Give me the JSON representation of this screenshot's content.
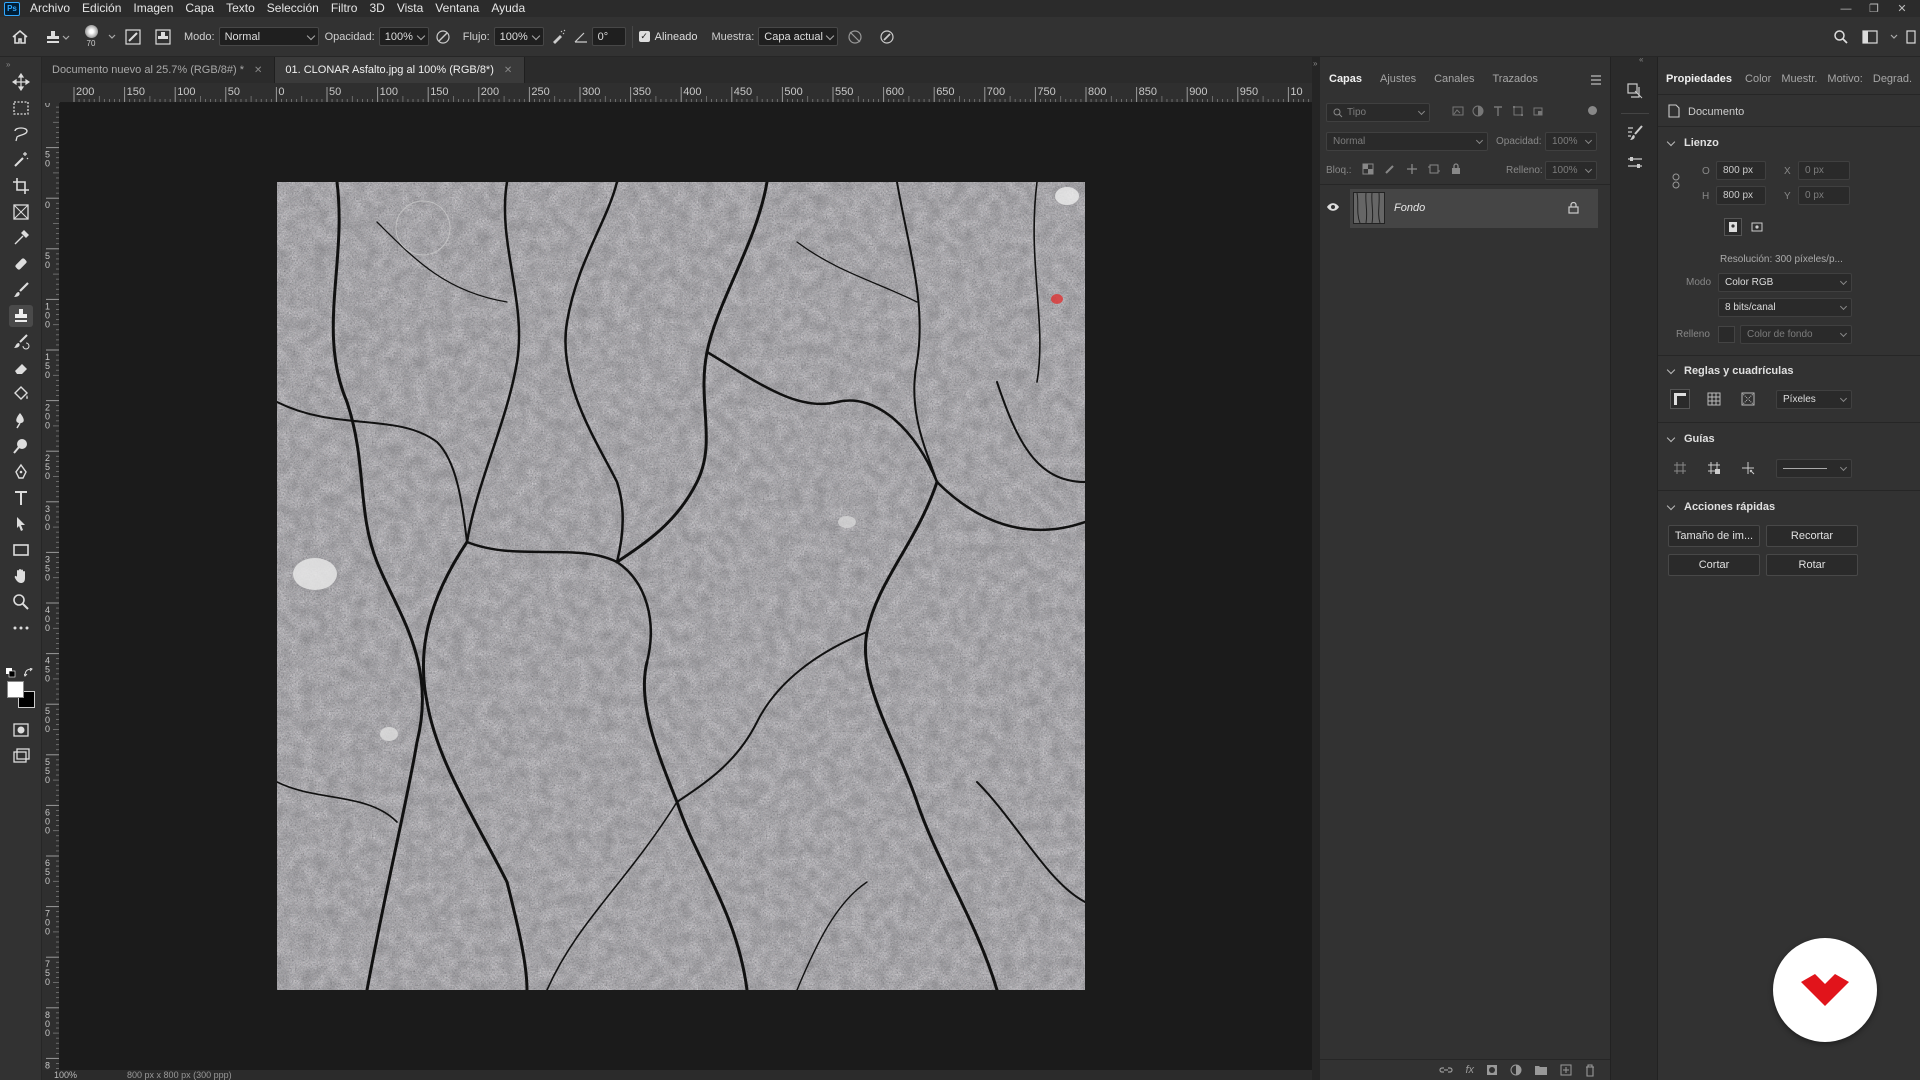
{
  "menubar": {
    "logo": "Ps",
    "items": [
      "Archivo",
      "Edición",
      "Imagen",
      "Capa",
      "Texto",
      "Selección",
      "Filtro",
      "3D",
      "Vista",
      "Ventana",
      "Ayuda"
    ]
  },
  "options": {
    "brush_size": "70",
    "mode_label": "Modo:",
    "mode_value": "Normal",
    "opacity_label": "Opacidad:",
    "opacity_value": "100%",
    "flow_label": "Flujo:",
    "flow_value": "100%",
    "angle_value": "0°",
    "aligned_label": "Alineado",
    "sample_label": "Muestra:",
    "sample_value": "Capa actual"
  },
  "tabs": [
    {
      "label": "Documento nuevo al 25.7% (RGB/8#) *"
    },
    {
      "label": "01. CLONAR Asfalto.jpg al 100% (RGB/8*)"
    }
  ],
  "ruler": {
    "h_labels": [
      "200",
      "150",
      "100",
      "50",
      "0",
      "50",
      "100",
      "150",
      "200",
      "250",
      "300",
      "350",
      "400",
      "450",
      "500",
      "550",
      "600",
      "650",
      "700",
      "750",
      "800",
      "850",
      "900",
      "950",
      "10"
    ],
    "v_labels": [
      "0",
      "50",
      "0",
      "50",
      "100",
      "150",
      "200",
      "250",
      "300",
      "350",
      "400",
      "450",
      "500",
      "550",
      "600",
      "650",
      "700",
      "750",
      "800",
      "850"
    ]
  },
  "status": {
    "zoom": "100%",
    "size": "800 px x 800 px (300 ppp)"
  },
  "layers_panel": {
    "tabs": [
      "Capas",
      "Ajustes",
      "Canales",
      "Trazados"
    ],
    "filter_placeholder": "Tipo",
    "blend_mode": "Normal",
    "opacity_label": "Opacidad:",
    "opacity_value": "100%",
    "lock_label": "Bloq.:",
    "fill_label": "Relleno:",
    "fill_value": "100%",
    "layers": [
      {
        "name": "Fondo"
      }
    ]
  },
  "properties_panel": {
    "tabs": [
      "Propiedades",
      "Color",
      "Muestr.",
      "Motivo:",
      "Degrad."
    ],
    "doc_label": "Documento",
    "canvas_section": "Lienzo",
    "width_label": "O",
    "width_value": "800 px",
    "height_label": "H",
    "height_value": "800 px",
    "x_label": "X",
    "x_value": "0 px",
    "y_label": "Y",
    "y_value": "0 px",
    "resolution": "Resolución: 300 píxeles/p...",
    "mode_label": "Modo",
    "mode_value": "Color RGB",
    "bits_value": "8 bits/canal",
    "fill_label": "Relleno",
    "fill_value": "Color de fondo",
    "rulers_section": "Reglas y cuadrículas",
    "units_value": "Píxeles",
    "guides_section": "Guías",
    "quick_section": "Acciones rápidas",
    "btn_image_size": "Tamaño de im...",
    "btn_crop": "Recortar",
    "btn_cut": "Cortar",
    "btn_rotate": "Rotar"
  },
  "colors": {
    "accent": "#31a8ff",
    "logo_red": "#e1141b"
  }
}
